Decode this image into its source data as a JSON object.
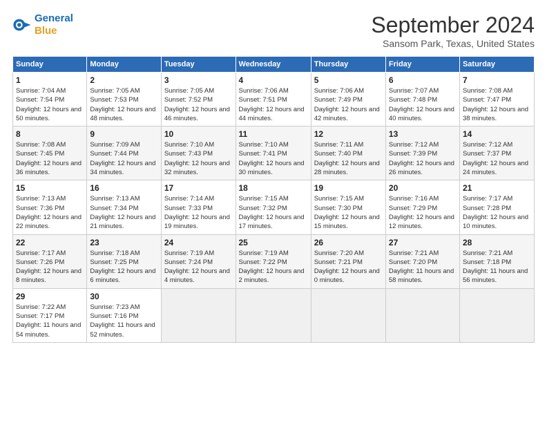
{
  "header": {
    "logo_line1": "General",
    "logo_line2": "Blue",
    "title": "September 2024",
    "subtitle": "Sansom Park, Texas, United States"
  },
  "columns": [
    "Sunday",
    "Monday",
    "Tuesday",
    "Wednesday",
    "Thursday",
    "Friday",
    "Saturday"
  ],
  "weeks": [
    [
      {
        "day": "1",
        "sunrise": "Sunrise: 7:04 AM",
        "sunset": "Sunset: 7:54 PM",
        "daylight": "Daylight: 12 hours and 50 minutes."
      },
      {
        "day": "2",
        "sunrise": "Sunrise: 7:05 AM",
        "sunset": "Sunset: 7:53 PM",
        "daylight": "Daylight: 12 hours and 48 minutes."
      },
      {
        "day": "3",
        "sunrise": "Sunrise: 7:05 AM",
        "sunset": "Sunset: 7:52 PM",
        "daylight": "Daylight: 12 hours and 46 minutes."
      },
      {
        "day": "4",
        "sunrise": "Sunrise: 7:06 AM",
        "sunset": "Sunset: 7:51 PM",
        "daylight": "Daylight: 12 hours and 44 minutes."
      },
      {
        "day": "5",
        "sunrise": "Sunrise: 7:06 AM",
        "sunset": "Sunset: 7:49 PM",
        "daylight": "Daylight: 12 hours and 42 minutes."
      },
      {
        "day": "6",
        "sunrise": "Sunrise: 7:07 AM",
        "sunset": "Sunset: 7:48 PM",
        "daylight": "Daylight: 12 hours and 40 minutes."
      },
      {
        "day": "7",
        "sunrise": "Sunrise: 7:08 AM",
        "sunset": "Sunset: 7:47 PM",
        "daylight": "Daylight: 12 hours and 38 minutes."
      }
    ],
    [
      {
        "day": "8",
        "sunrise": "Sunrise: 7:08 AM",
        "sunset": "Sunset: 7:45 PM",
        "daylight": "Daylight: 12 hours and 36 minutes."
      },
      {
        "day": "9",
        "sunrise": "Sunrise: 7:09 AM",
        "sunset": "Sunset: 7:44 PM",
        "daylight": "Daylight: 12 hours and 34 minutes."
      },
      {
        "day": "10",
        "sunrise": "Sunrise: 7:10 AM",
        "sunset": "Sunset: 7:43 PM",
        "daylight": "Daylight: 12 hours and 32 minutes."
      },
      {
        "day": "11",
        "sunrise": "Sunrise: 7:10 AM",
        "sunset": "Sunset: 7:41 PM",
        "daylight": "Daylight: 12 hours and 30 minutes."
      },
      {
        "day": "12",
        "sunrise": "Sunrise: 7:11 AM",
        "sunset": "Sunset: 7:40 PM",
        "daylight": "Daylight: 12 hours and 28 minutes."
      },
      {
        "day": "13",
        "sunrise": "Sunrise: 7:12 AM",
        "sunset": "Sunset: 7:39 PM",
        "daylight": "Daylight: 12 hours and 26 minutes."
      },
      {
        "day": "14",
        "sunrise": "Sunrise: 7:12 AM",
        "sunset": "Sunset: 7:37 PM",
        "daylight": "Daylight: 12 hours and 24 minutes."
      }
    ],
    [
      {
        "day": "15",
        "sunrise": "Sunrise: 7:13 AM",
        "sunset": "Sunset: 7:36 PM",
        "daylight": "Daylight: 12 hours and 22 minutes."
      },
      {
        "day": "16",
        "sunrise": "Sunrise: 7:13 AM",
        "sunset": "Sunset: 7:34 PM",
        "daylight": "Daylight: 12 hours and 21 minutes."
      },
      {
        "day": "17",
        "sunrise": "Sunrise: 7:14 AM",
        "sunset": "Sunset: 7:33 PM",
        "daylight": "Daylight: 12 hours and 19 minutes."
      },
      {
        "day": "18",
        "sunrise": "Sunrise: 7:15 AM",
        "sunset": "Sunset: 7:32 PM",
        "daylight": "Daylight: 12 hours and 17 minutes."
      },
      {
        "day": "19",
        "sunrise": "Sunrise: 7:15 AM",
        "sunset": "Sunset: 7:30 PM",
        "daylight": "Daylight: 12 hours and 15 minutes."
      },
      {
        "day": "20",
        "sunrise": "Sunrise: 7:16 AM",
        "sunset": "Sunset: 7:29 PM",
        "daylight": "Daylight: 12 hours and 12 minutes."
      },
      {
        "day": "21",
        "sunrise": "Sunrise: 7:17 AM",
        "sunset": "Sunset: 7:28 PM",
        "daylight": "Daylight: 12 hours and 10 minutes."
      }
    ],
    [
      {
        "day": "22",
        "sunrise": "Sunrise: 7:17 AM",
        "sunset": "Sunset: 7:26 PM",
        "daylight": "Daylight: 12 hours and 8 minutes."
      },
      {
        "day": "23",
        "sunrise": "Sunrise: 7:18 AM",
        "sunset": "Sunset: 7:25 PM",
        "daylight": "Daylight: 12 hours and 6 minutes."
      },
      {
        "day": "24",
        "sunrise": "Sunrise: 7:19 AM",
        "sunset": "Sunset: 7:24 PM",
        "daylight": "Daylight: 12 hours and 4 minutes."
      },
      {
        "day": "25",
        "sunrise": "Sunrise: 7:19 AM",
        "sunset": "Sunset: 7:22 PM",
        "daylight": "Daylight: 12 hours and 2 minutes."
      },
      {
        "day": "26",
        "sunrise": "Sunrise: 7:20 AM",
        "sunset": "Sunset: 7:21 PM",
        "daylight": "Daylight: 12 hours and 0 minutes."
      },
      {
        "day": "27",
        "sunrise": "Sunrise: 7:21 AM",
        "sunset": "Sunset: 7:20 PM",
        "daylight": "Daylight: 11 hours and 58 minutes."
      },
      {
        "day": "28",
        "sunrise": "Sunrise: 7:21 AM",
        "sunset": "Sunset: 7:18 PM",
        "daylight": "Daylight: 11 hours and 56 minutes."
      }
    ],
    [
      {
        "day": "29",
        "sunrise": "Sunrise: 7:22 AM",
        "sunset": "Sunset: 7:17 PM",
        "daylight": "Daylight: 11 hours and 54 minutes."
      },
      {
        "day": "30",
        "sunrise": "Sunrise: 7:23 AM",
        "sunset": "Sunset: 7:16 PM",
        "daylight": "Daylight: 11 hours and 52 minutes."
      },
      null,
      null,
      null,
      null,
      null
    ]
  ]
}
